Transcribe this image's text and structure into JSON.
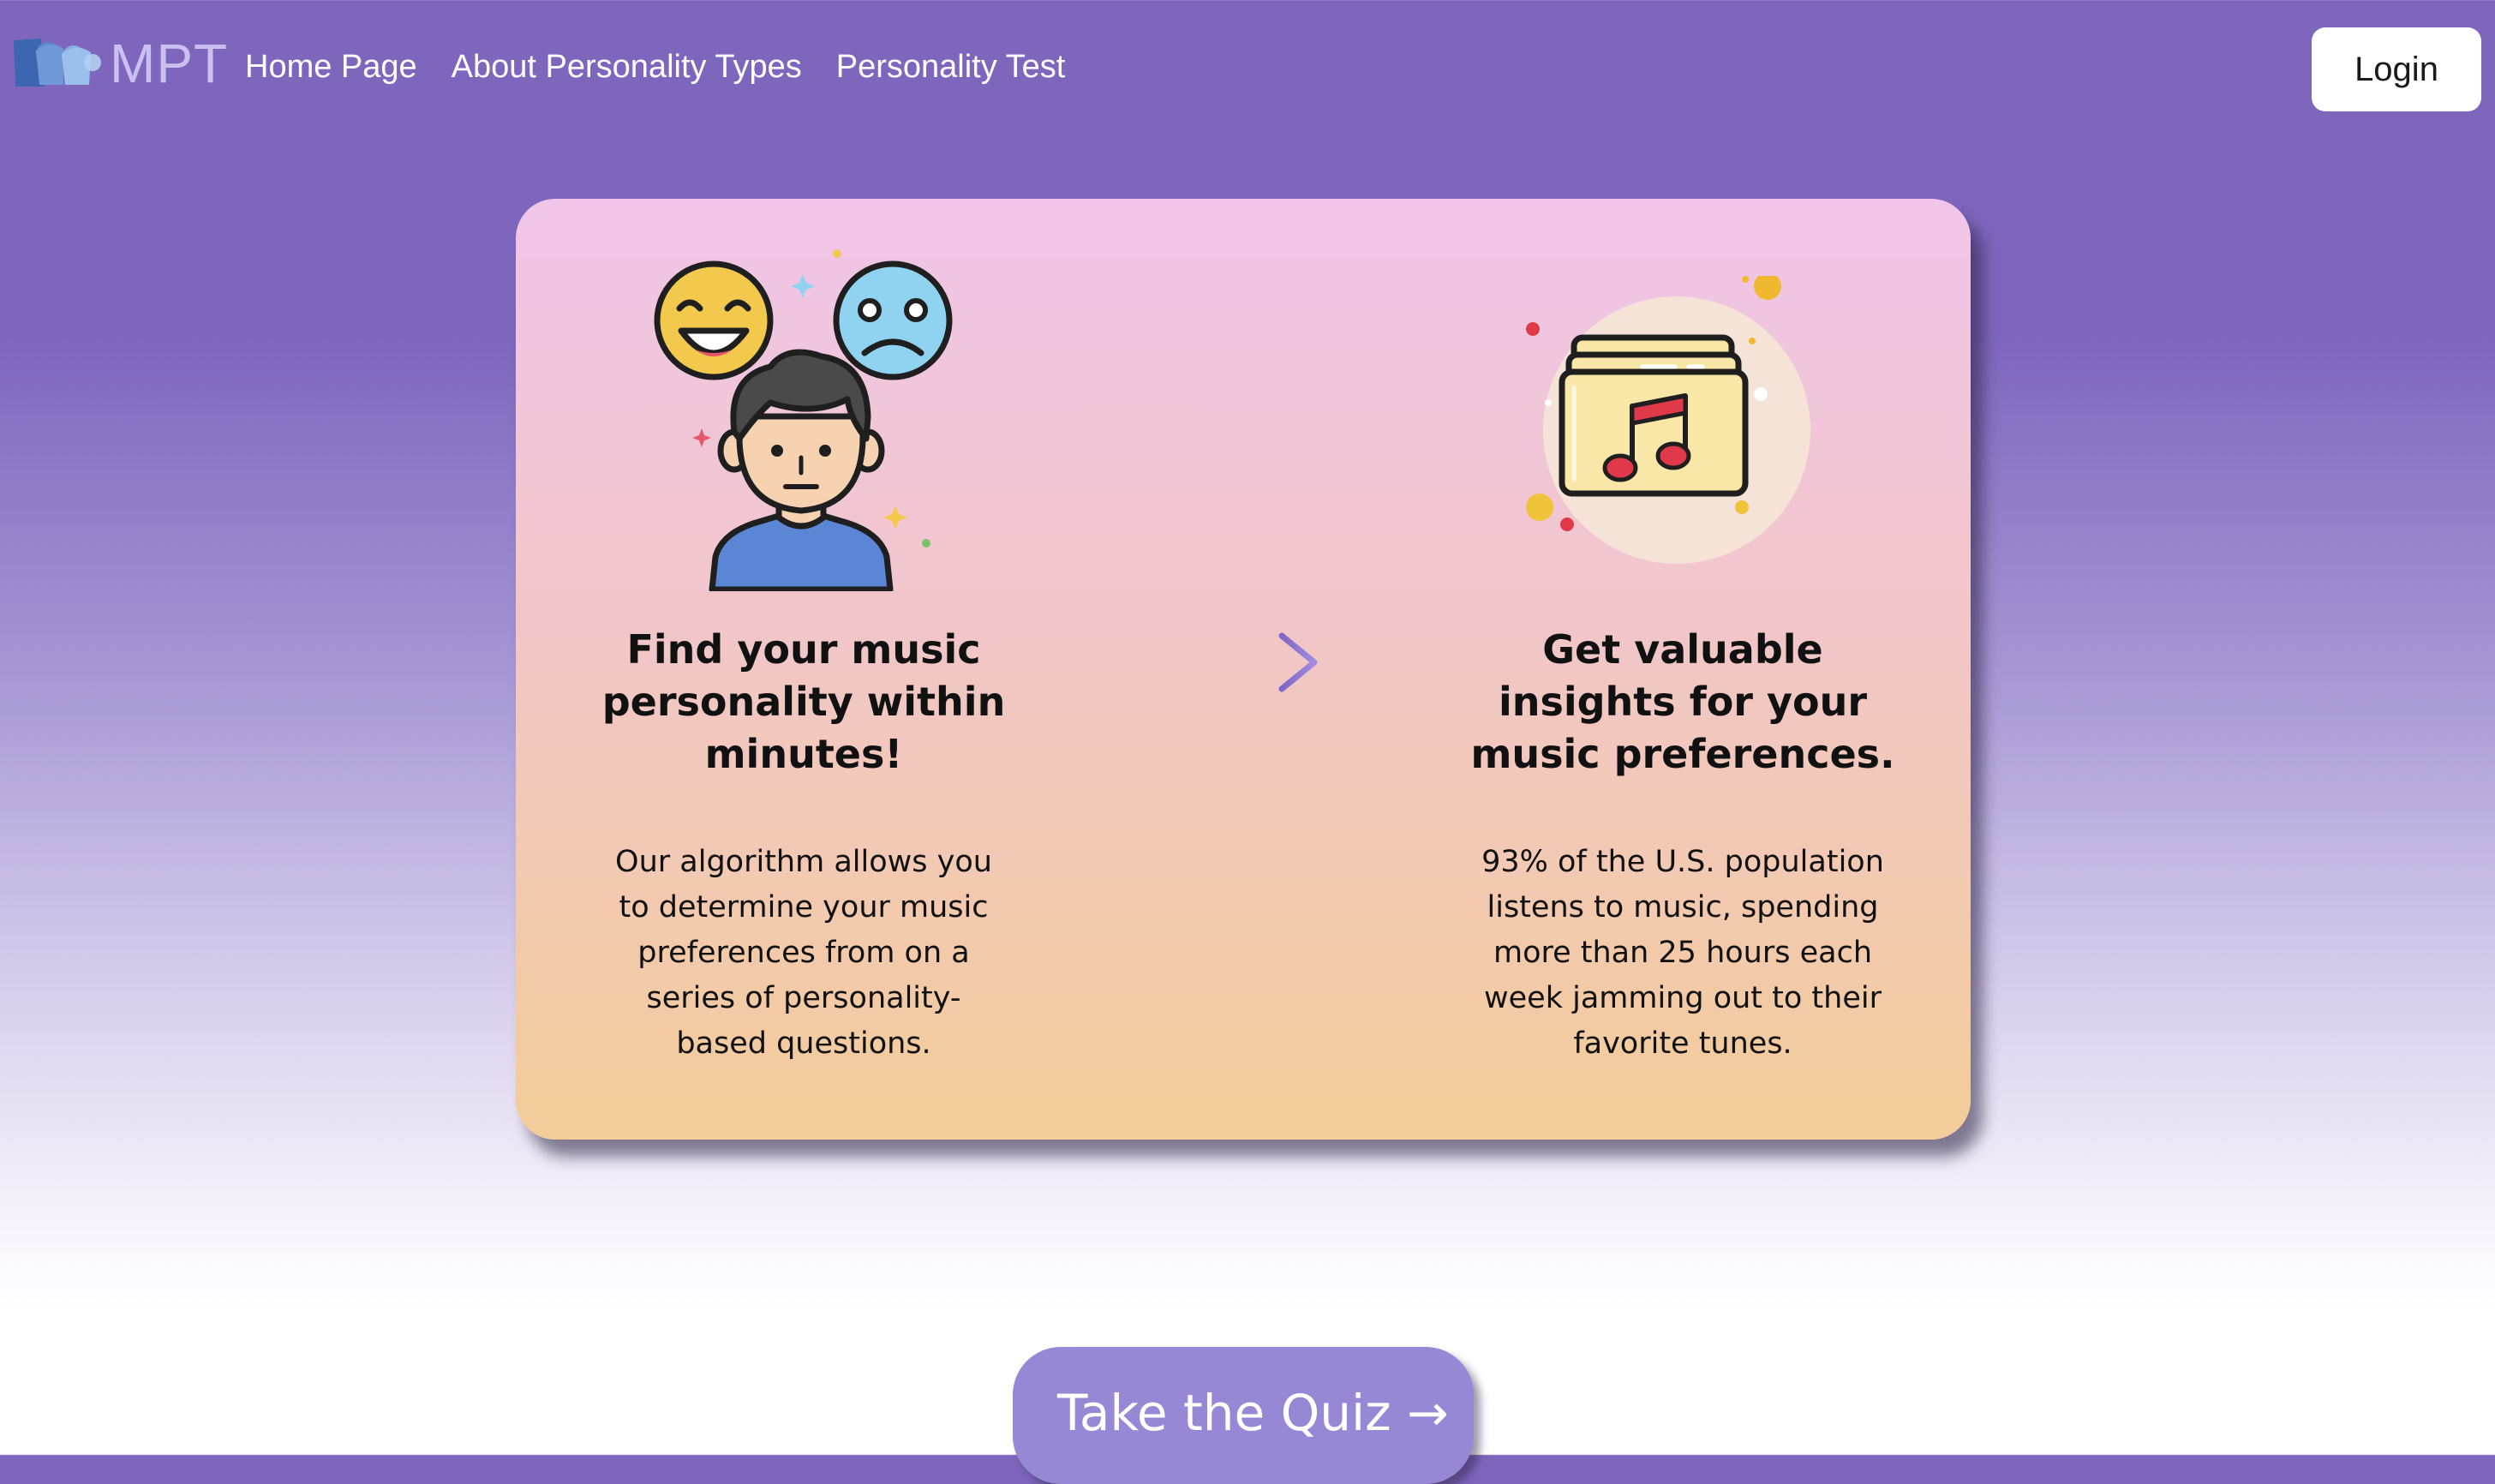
{
  "nav": {
    "logo_text": "MPT",
    "links": [
      "Home Page",
      "About Personality Types",
      "Personality Test"
    ],
    "login_label": "Login"
  },
  "card": {
    "left": {
      "illustration": "person-with-emotion-faces-icon",
      "heading": "Find your music personality within minutes!",
      "text": "Our algorithm allows you to determine your music preferences from on a series of personality-based questions."
    },
    "arrow_icon": "arrow-right-icon",
    "right": {
      "illustration": "music-folder-icon",
      "heading": "Get valuable insights for your music preferences.",
      "text": "93% of the U.S. population listens to music, spending more than 25 hours each week jamming out to their favorite tunes."
    }
  },
  "cta": {
    "label": "Take the Quiz →"
  },
  "colors": {
    "nav_background": "#7e66bd",
    "card_top": "#f0c5e9",
    "card_bottom": "#f3cc99",
    "accent_purple": "#9688d4",
    "arrow": "#8a72cc"
  }
}
